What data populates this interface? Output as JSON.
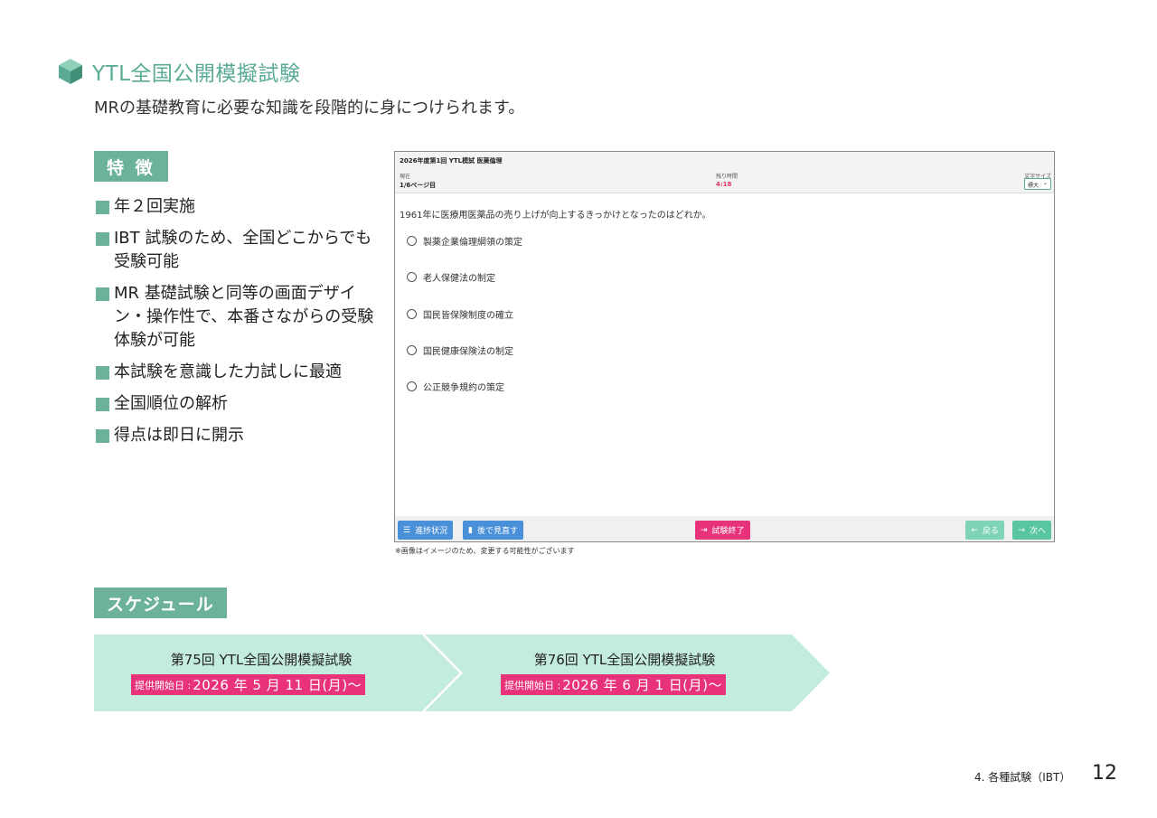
{
  "header": {
    "title": "YTL全国公開模擬試験",
    "subtitle": "MRの基礎教育に必要な知識を段階的に身につけられます。"
  },
  "colors": {
    "accent": "#6bb19c",
    "title": "#5aab95",
    "arrow_fill": "#c3ebde",
    "date_badge": "#e8337a"
  },
  "features": {
    "tag": "特 徴",
    "items": [
      "年２回実施",
      "IBT 試験のため、全国どこからでも受験可能",
      "MR 基礎試験と同等の画面デザイン・操作性で、本番さながらの受験体験が可能",
      "本試験を意識した力試しに最適",
      "全国順位の解析",
      "得点は即日に開示"
    ]
  },
  "exam_screen": {
    "exam_title": "2026年度第1回 YTL模試 医薬倫理",
    "current_label": "現在",
    "current_value": "1/6ページ目",
    "remaining_label": "残り時間",
    "remaining_value": "4:18",
    "font_size_label": "文字サイズ",
    "font_size_value": "標大",
    "question": "1961年に医療用医薬品の売り上げが向上するきっかけとなったのはどれか。",
    "options": [
      "製薬企業倫理綱領の策定",
      "老人保健法の制定",
      "国民皆保険制度の確立",
      "国民健康保険法の制定",
      "公正競争規約の策定"
    ],
    "buttons": {
      "progress": "進捗状況",
      "later": "後で見直す",
      "end": "試験終了",
      "back": "戻る",
      "next": "次へ"
    },
    "icons": {
      "progress": "list-icon",
      "later": "bookmark-icon",
      "end": "exit-icon",
      "back": "arrow-left-icon",
      "next": "arrow-right-icon"
    }
  },
  "note": "※画像はイメージのため、変更する可能性がございます",
  "schedule": {
    "tag": "スケジュール",
    "items": [
      {
        "title": "第75回 YTL全国公開模擬試験",
        "date_label": "提供開始日 :",
        "date": "2026 年 5 月 11 日(月)〜"
      },
      {
        "title": "第76回 YTL全国公開模擬試験",
        "date_label": "提供開始日 :",
        "date": "2026 年 6 月 1 日(月)〜"
      }
    ]
  },
  "footer": {
    "label": "4. 各種試験（IBT）",
    "page": "12"
  }
}
